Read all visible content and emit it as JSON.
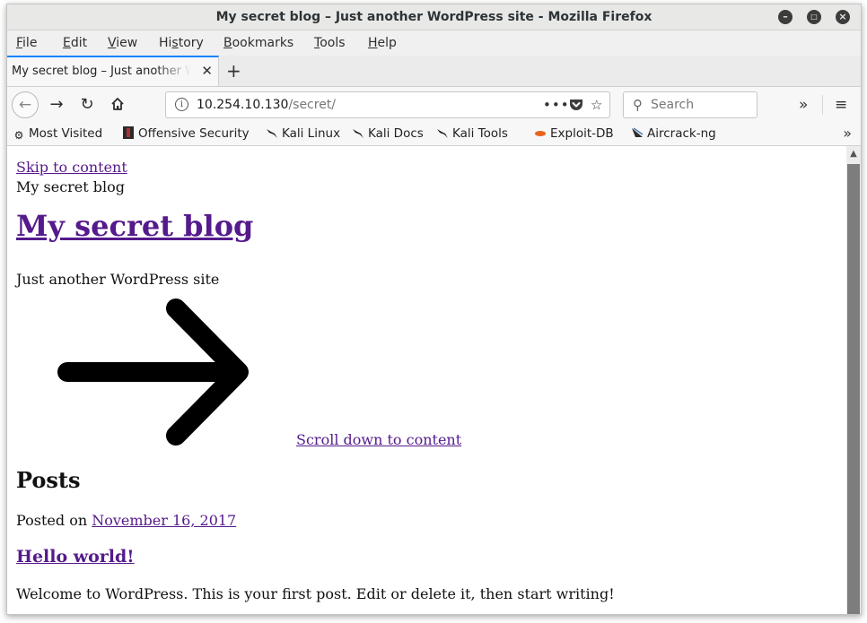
{
  "window": {
    "title": "My secret blog – Just another WordPress site - Mozilla Firefox"
  },
  "menu": {
    "file": "File",
    "edit": "Edit",
    "view": "View",
    "history": "History",
    "bookmarks": "Bookmarks",
    "tools": "Tools",
    "help": "Help"
  },
  "tab": {
    "title": "My secret blog – Just another WordPress site",
    "close": "✕",
    "new_tab": "+"
  },
  "navbar": {
    "url_host": "10.254.10.130",
    "url_path": "/secret/",
    "search_placeholder": "Search"
  },
  "bookmarks_toolbar": {
    "items": [
      {
        "label": "Most Visited",
        "icon": "gear-icon"
      },
      {
        "label": "Offensive Security",
        "icon": "offsec-icon"
      },
      {
        "label": "Kali Linux",
        "icon": "kali-dragon-icon"
      },
      {
        "label": "Kali Docs",
        "icon": "kali-dragon-icon"
      },
      {
        "label": "Kali Tools",
        "icon": "kali-dragon-icon"
      },
      {
        "label": "Exploit-DB",
        "icon": "exploitdb-icon"
      },
      {
        "label": "Aircrack-ng",
        "icon": "aircrack-icon"
      }
    ]
  },
  "page": {
    "skip_link": "Skip to content",
    "site_title_small": "My secret blog",
    "site_title": "My secret blog",
    "tagline": "Just another WordPress site",
    "scroll_down": "Scroll down to content",
    "posts_heading": "Posts",
    "posted_on": "Posted on",
    "post_date": "November 16, 2017",
    "post_title": "Hello world!",
    "post_excerpt": "Welcome to WordPress. This is your first post. Edit or delete it, then start writing!"
  },
  "colors": {
    "link": "#551a8b",
    "focus_accent": "#0a84ff",
    "scroll_thumb": "#7d7d7d"
  }
}
